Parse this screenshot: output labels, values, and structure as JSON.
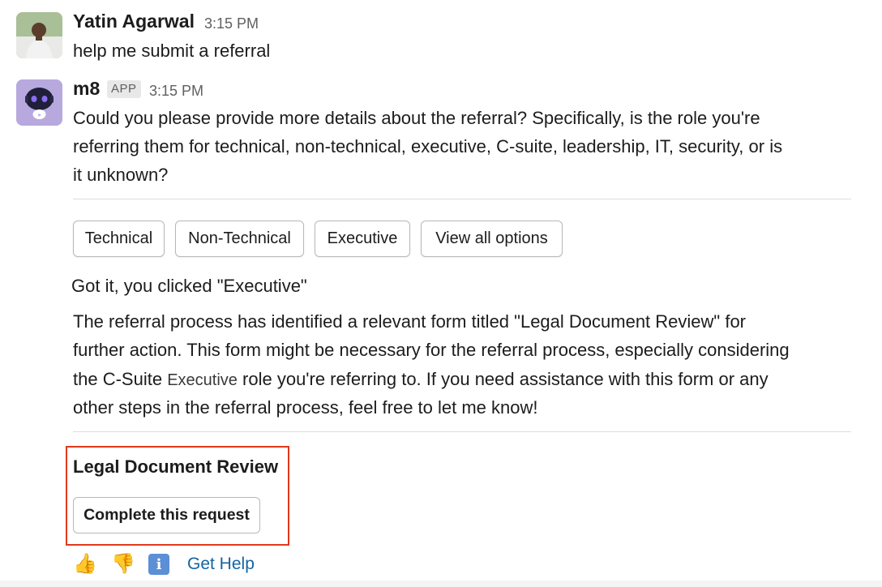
{
  "messages": [
    {
      "author": "Yatin Agarwal",
      "time": "3:15 PM",
      "text": "help me submit a referral",
      "avatar_icon": "user-photo-avatar"
    },
    {
      "author": "m8",
      "badge": "APP",
      "time": "3:15 PM",
      "text_lines": [
        "Could you please provide more details about the referral? Specifically, is the role you're",
        "referring them for technical, non-technical, executive, C-suite, leadership, IT, security, or is",
        "it unknown?"
      ],
      "avatar_icon": "robot-avatar"
    }
  ],
  "choice_buttons": [
    "Technical",
    "Non-Technical",
    "Executive",
    "View all options"
  ],
  "clicked_text": "Got it, you clicked \"Executive\"",
  "response_lines": [
    "The referral process has identified a relevant form titled \"Legal Document Review\" for",
    "further action. This form might be necessary for the referral process, especially considering",
    "the C-Suite",
    "Executive",
    "role you're referring to. If you need assistance with this form or any",
    "other steps in the referral process, feel free to let me know!"
  ],
  "form": {
    "title": "Legal Document Review",
    "button_label": "Complete this request",
    "highlight_color": "#e0391b"
  },
  "feedback": {
    "thumbs_up_icon": "👍",
    "thumbs_down_icon": "👎",
    "info_icon": "i",
    "get_help": "Get Help"
  },
  "colors": {
    "link": "#1264a3",
    "bot_avatar_bg": "#b7a9de"
  }
}
